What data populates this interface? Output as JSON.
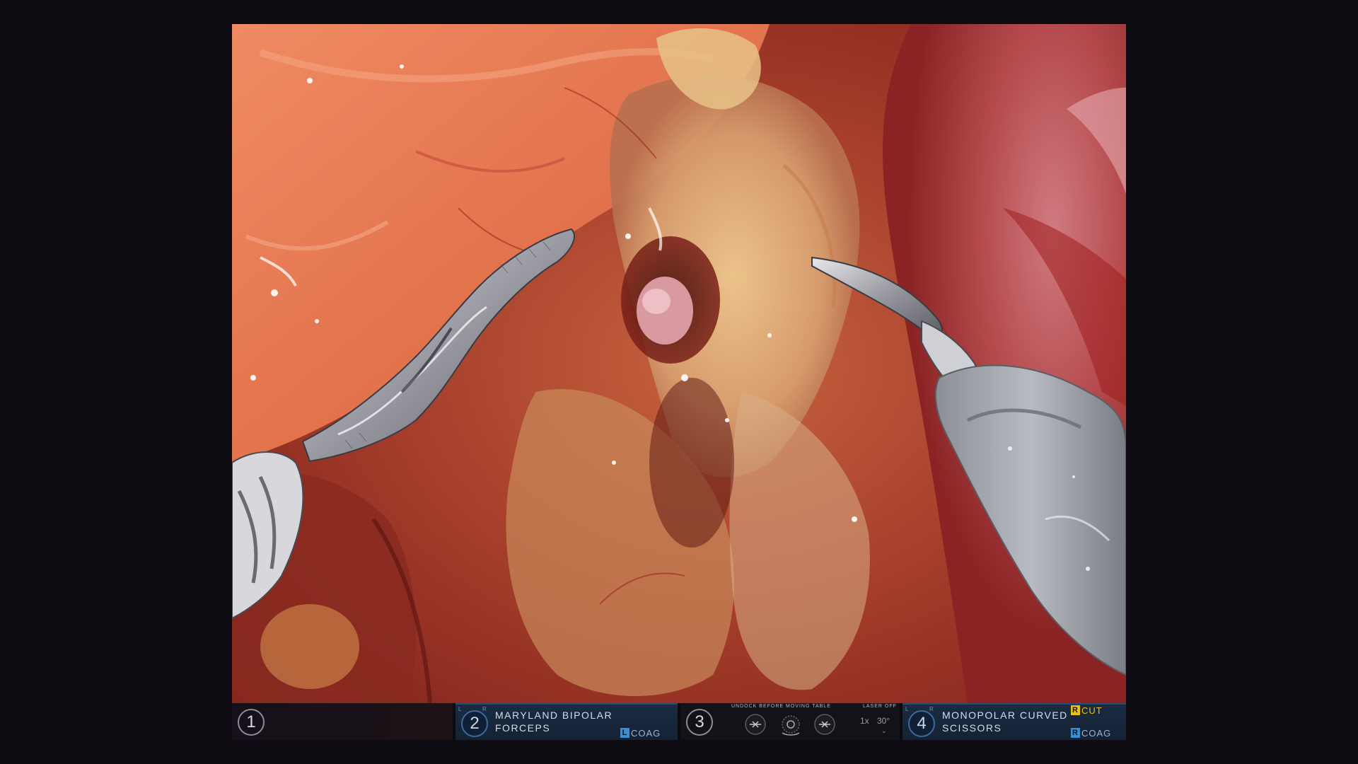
{
  "arms": [
    {
      "number": "1",
      "instrument": "",
      "hand": ""
    },
    {
      "number": "2",
      "hand_left": "L",
      "hand_right": "R",
      "instrument_line1": "MARYLAND BIPOLAR",
      "instrument_line2": "FORCEPS",
      "energy": [
        {
          "badge": "L",
          "mode": "COAG"
        }
      ]
    },
    {
      "number": "3",
      "message": "UNDOCK BEFORE MOVING TABLE",
      "laser": "LASER OFF",
      "zoom": "1x",
      "angle": "30°"
    },
    {
      "number": "4",
      "hand_left": "L",
      "hand_right": "R",
      "instrument_line1": "MONOPOLAR CURVED",
      "instrument_line2": "SCISSORS",
      "energy": [
        {
          "badge": "R",
          "mode": "CUT"
        },
        {
          "badge": "R",
          "mode": "COAG"
        }
      ]
    }
  ],
  "colors": {
    "background": "#0e0b12",
    "tissue_base": "#9e2e22",
    "active_panel": "#1a2b42",
    "coag_badge": "#3a8ed0",
    "cut_badge": "#e8c21a"
  },
  "icons": {
    "arm3_left": "undock-icon",
    "arm3_center": "table-icon",
    "arm3_right": "undock-icon"
  }
}
